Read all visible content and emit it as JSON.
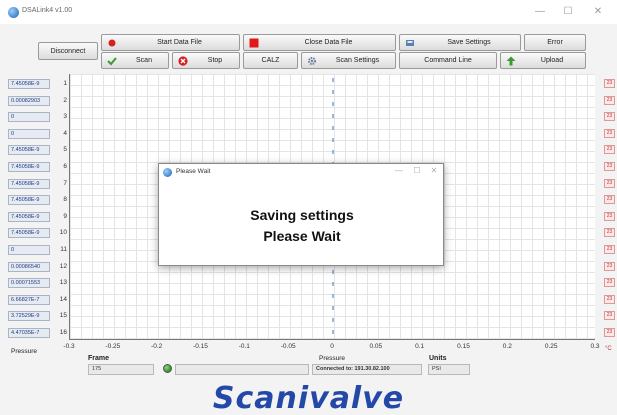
{
  "window": {
    "title": "DSALink4 v1.00",
    "minimize": "—",
    "maximize": "☐",
    "close": "✕"
  },
  "toolbar": {
    "disconnect": "Disconnect",
    "start_data_file": "Start Data File",
    "close_data_file": "Close Data File",
    "save_settings": "Save Settings",
    "error": "Error",
    "scan": "Scan",
    "stop": "Stop",
    "calz": "CALZ",
    "scan_settings": "Scan Settings",
    "command_line": "Command Line",
    "upload": "Upload"
  },
  "channels": [
    {
      "value": "7.45058E-9",
      "num": "1"
    },
    {
      "value": "0.00082903",
      "num": "2"
    },
    {
      "value": "0",
      "num": "3"
    },
    {
      "value": "0",
      "num": "4"
    },
    {
      "value": "7.45058E-9",
      "num": "5"
    },
    {
      "value": "7.45058E-9",
      "num": "6"
    },
    {
      "value": "7.45058E-9",
      "num": "7"
    },
    {
      "value": "7.45058E-9",
      "num": "8"
    },
    {
      "value": "7.45058E-9",
      "num": "9"
    },
    {
      "value": "7.45058E-9",
      "num": "10"
    },
    {
      "value": "0",
      "num": "11"
    },
    {
      "value": "0.00086540",
      "num": "12"
    },
    {
      "value": "0.00071553",
      "num": "13"
    },
    {
      "value": "6.66827E-7",
      "num": "14"
    },
    {
      "value": "3.72529E-9",
      "num": "15"
    },
    {
      "value": "4.47035E-7",
      "num": "16"
    }
  ],
  "temps": [
    "23",
    "23",
    "23",
    "23",
    "23",
    "23",
    "23",
    "23",
    "23",
    "23",
    "23",
    "23",
    "23",
    "23",
    "23",
    "23"
  ],
  "temp_unit": "°C",
  "x_ticks": [
    "-0.3",
    "-0.25",
    "-0.2",
    "-0.15",
    "-0.1",
    "-0.05",
    "0",
    "0.05",
    "0.1",
    "0.15",
    "0.2",
    "0.25",
    "0.3"
  ],
  "bottom": {
    "pressure_left": "Pressure",
    "frame_label": "Frame",
    "frame_value": "175",
    "pressure_label": "Pressure",
    "status": "Connected to: 191.30.82.100",
    "units_label": "Units",
    "units_value": "PSI"
  },
  "dialog": {
    "title": "Please Wait",
    "line1": "Saving settings",
    "line2": "Please Wait",
    "minimize": "—",
    "maximize": "☐",
    "close": "✕"
  },
  "brand": "Scanivalve",
  "colors": {
    "indicator_text": "#1f3b80",
    "brand": "#2448a8",
    "temp_text": "#cc3333"
  }
}
